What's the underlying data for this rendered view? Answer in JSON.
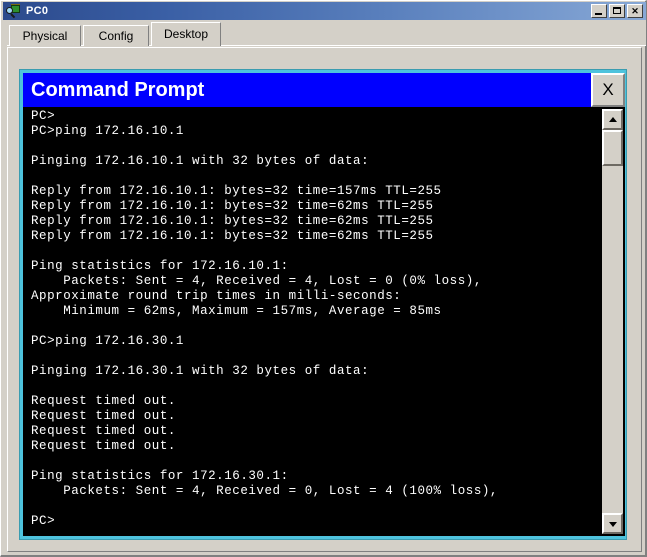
{
  "window": {
    "title": "PC0",
    "icon": "packet-tracer-device-icon",
    "controls": {
      "minimize": "_",
      "maximize": "▢",
      "close": "✕"
    }
  },
  "tabs": [
    {
      "label": "Physical",
      "selected": false
    },
    {
      "label": "Config",
      "selected": false
    },
    {
      "label": "Desktop",
      "selected": true
    }
  ],
  "command_prompt": {
    "title": "Command Prompt",
    "close_label": "X",
    "scrollbar": {
      "up_arrow": "scroll-up-arrow-icon",
      "down_arrow": "scroll-down-arrow-icon"
    },
    "console_output": "PC>\nPC>ping 172.16.10.1\n\nPinging 172.16.10.1 with 32 bytes of data:\n\nReply from 172.16.10.1: bytes=32 time=157ms TTL=255\nReply from 172.16.10.1: bytes=32 time=62ms TTL=255\nReply from 172.16.10.1: bytes=32 time=62ms TTL=255\nReply from 172.16.10.1: bytes=32 time=62ms TTL=255\n\nPing statistics for 172.16.10.1:\n    Packets: Sent = 4, Received = 4, Lost = 0 (0% loss),\nApproximate round trip times in milli-seconds:\n    Minimum = 62ms, Maximum = 157ms, Average = 85ms\n\nPC>ping 172.16.30.1\n\nPinging 172.16.30.1 with 32 bytes of data:\n\nRequest timed out.\nRequest timed out.\nRequest timed out.\nRequest timed out.\n\nPing statistics for 172.16.30.1:\n    Packets: Sent = 4, Received = 0, Lost = 4 (100% loss),\n\nPC>"
  },
  "colors": {
    "titlebar_start": "#2c4a8c",
    "titlebar_end": "#87a8d6",
    "cmd_titlebar": "#0000ff",
    "cmd_border": "#4ec3dd",
    "console_bg": "#000000",
    "console_fg": "#ffffff",
    "panel_bg": "#d4d0c8"
  }
}
